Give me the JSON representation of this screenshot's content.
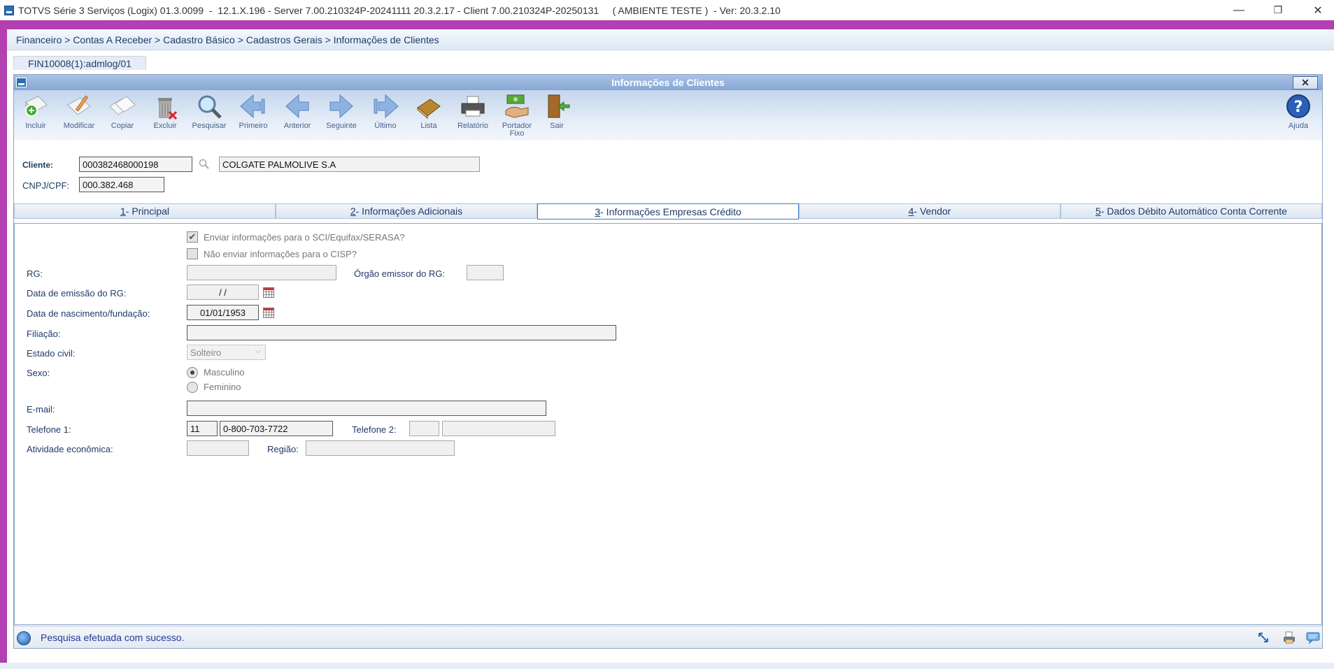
{
  "titlebar": {
    "title": "TOTVS Série 3 Serviços (Logix) 01.3.0099  -  12.1.X.196 - Server 7.00.210324P-20241111 20.3.2.17 - Client 7.00.210324P-20250131     ( AMBIENTE TESTE )  - Ver: 20.3.2.10",
    "minimize": "—",
    "maximize": "❐",
    "close": "✕"
  },
  "breadcrumb": "Financeiro > Contas A Receber > Cadastro Básico > Cadastros Gerais > Informações de Clientes",
  "program_tab": "FIN10008(1):admlog/01",
  "window": {
    "title": "Informações de Clientes",
    "close": "✕"
  },
  "toolbar": {
    "incluir": "Incluir",
    "modificar": "Modificar",
    "copiar": "Copiar",
    "excluir": "Excluir",
    "pesquisar": "Pesquisar",
    "primeiro": "Primeiro",
    "anterior": "Anterior",
    "seguinte": "Seguinte",
    "ultimo": "Último",
    "lista": "Lista",
    "relatorio": "Relatório",
    "portador_l1": "Portador",
    "portador_l2": "Fixo",
    "sair": "Sair",
    "ajuda": "Ajuda"
  },
  "header": {
    "cliente_label": "Cliente:",
    "cliente_code": "000382468000198",
    "cliente_name": "COLGATE PALMOLIVE S.A",
    "cnpj_label": "CNPJ/CPF:",
    "cnpj_value": "000.382.468"
  },
  "tabs": [
    {
      "num": "1",
      "label": " - Principal"
    },
    {
      "num": "2",
      "label": " - Informações Adicionais"
    },
    {
      "num": "3",
      "label": " - Informações Empresas Crédito"
    },
    {
      "num": "4",
      "label": " - Vendor"
    },
    {
      "num": "5",
      "label": " - Dados Débito Automático Conta Corrente"
    }
  ],
  "form": {
    "chk_serasa": "Enviar informações para o SCI/Equifax/SERASA?",
    "chk_serasa_checked": true,
    "chk_cisp": "Não enviar informações para o CISP?",
    "chk_cisp_checked": false,
    "rg_label": "RG:",
    "rg_value": "",
    "orgao_label": "Órgão emissor do RG:",
    "orgao_value": "",
    "data_emissao_label": "Data de emissão do RG:",
    "data_emissao_value": "/  /",
    "data_nasc_label": "Data de nascimento/fundação:",
    "data_nasc_value": "01/01/1953",
    "filiacao_label": "Filiação:",
    "filiacao_value": "",
    "estado_civil_label": "Estado civil:",
    "estado_civil_value": "Solteiro",
    "sexo_label": "Sexo:",
    "sexo_masc": "Masculino",
    "sexo_fem": "Feminino",
    "sexo_selected": "Masculino",
    "email_label": "E-mail:",
    "email_value": "",
    "tel1_label": "Telefone 1:",
    "tel1_ddd": "11",
    "tel1_num": "0-800-703-7722",
    "tel2_label": "Telefone 2:",
    "tel2_ddd": "",
    "tel2_num": "",
    "atividade_label": "Atividade econômica:",
    "atividade_value": "",
    "regiao_label": "Região:",
    "regiao_value": ""
  },
  "status": {
    "message": "Pesquisa efetuada com sucesso."
  }
}
